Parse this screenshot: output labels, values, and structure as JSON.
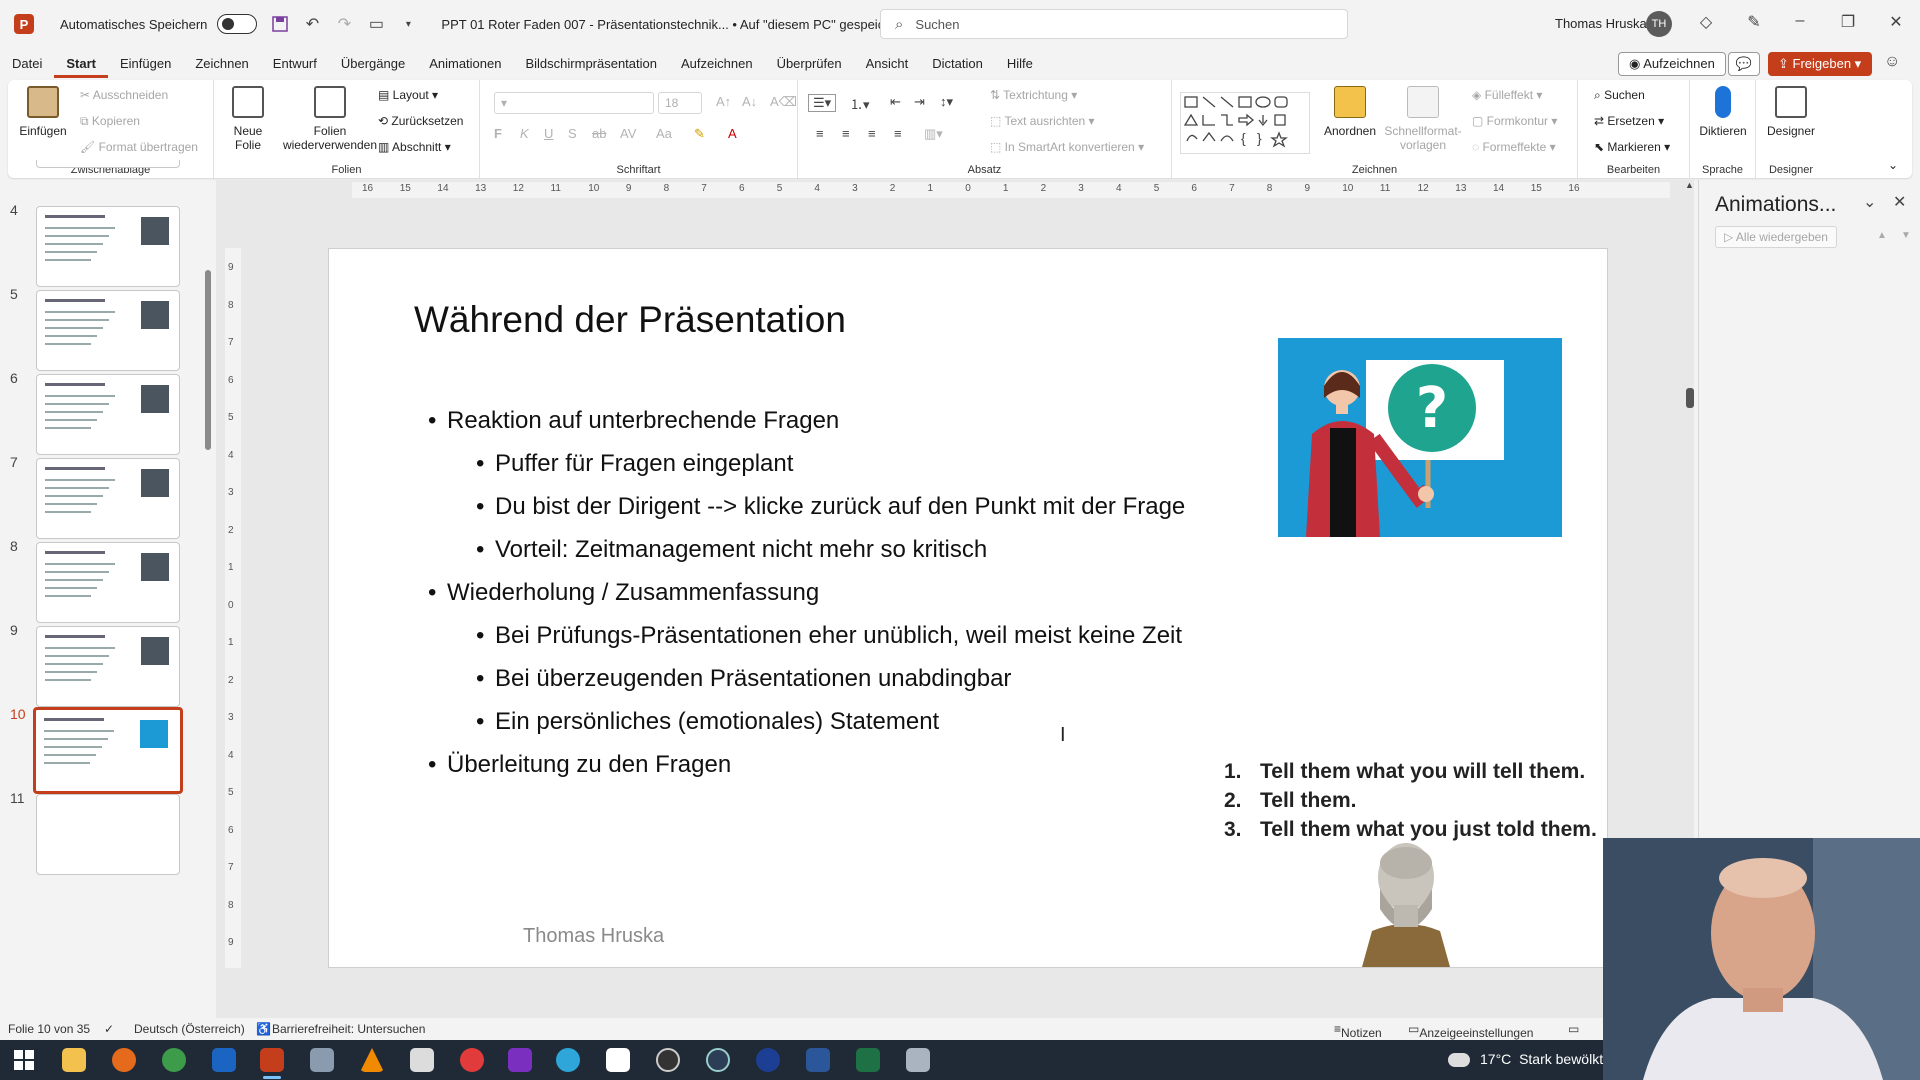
{
  "titlebar": {
    "autosave_label": "Automatisches Speichern",
    "doc_title": "PPT 01 Roter Faden 007 - Präsentationstechnik... • Auf \"diesem PC\" gespeichert",
    "search_placeholder": "Suchen",
    "user_name": "Thomas Hruska",
    "user_initials": "TH"
  },
  "menu": {
    "tabs": [
      "Datei",
      "Start",
      "Einfügen",
      "Zeichnen",
      "Entwurf",
      "Übergänge",
      "Animationen",
      "Bildschirmpräsentation",
      "Aufzeichnen",
      "Überprüfen",
      "Ansicht",
      "Dictation",
      "Hilfe"
    ],
    "active": "Start",
    "record_label": "Aufzeichnen",
    "share_label": "Freigeben"
  },
  "ribbon": {
    "clipboard": {
      "label": "Zwischenablage",
      "paste": "Einfügen",
      "cut": "Ausschneiden",
      "copy": "Kopieren",
      "format_painter": "Format übertragen"
    },
    "slides": {
      "label": "Folien",
      "new_slide": "Neue Folie",
      "reuse": "Folien wiederverwenden",
      "layout": "Layout",
      "reset": "Zurücksetzen",
      "section": "Abschnitt"
    },
    "font": {
      "label": "Schriftart",
      "size": "18"
    },
    "paragraph": {
      "label": "Absatz",
      "text_direction": "Textrichtung",
      "align_text": "Text ausrichten",
      "smartart": "In SmartArt konvertieren"
    },
    "drawing": {
      "label": "Zeichnen",
      "arrange": "Anordnen",
      "quick_styles": "Schnellformat-vorlagen",
      "fill": "Fülleffekt",
      "outline": "Formkontur",
      "effects": "Formeffekte"
    },
    "editing": {
      "label": "Bearbeiten",
      "find": "Suchen",
      "replace": "Ersetzen",
      "select": "Markieren"
    },
    "voice": {
      "label": "Sprache",
      "dictate": "Diktieren"
    },
    "designer": {
      "label": "Designer",
      "button": "Designer"
    }
  },
  "thumbnails": {
    "numbers": [
      "4",
      "5",
      "6",
      "7",
      "8",
      "9",
      "10",
      "11"
    ],
    "selected": "10"
  },
  "ruler": {
    "h_ticks": [
      "16",
      "15",
      "14",
      "13",
      "12",
      "11",
      "10",
      "9",
      "8",
      "7",
      "6",
      "5",
      "4",
      "3",
      "2",
      "1",
      "0",
      "1",
      "2",
      "3",
      "4",
      "5",
      "6",
      "7",
      "8",
      "9",
      "10",
      "11",
      "12",
      "13",
      "14",
      "15",
      "16"
    ],
    "v_ticks": [
      "9",
      "8",
      "7",
      "6",
      "5",
      "4",
      "3",
      "2",
      "1",
      "0",
      "1",
      "2",
      "3",
      "4",
      "5",
      "6",
      "7",
      "8",
      "9"
    ]
  },
  "slide": {
    "title": "Während der Präsentation",
    "bullets": [
      {
        "level": 1,
        "text": "Reaktion auf unterbrechende Fragen"
      },
      {
        "level": 2,
        "text": "Puffer für Fragen eingeplant"
      },
      {
        "level": 2,
        "text": "Du bist der Dirigent --> klicke zurück auf den Punkt mit der Frage"
      },
      {
        "level": 2,
        "text": "Vorteil: Zeitmanagement nicht mehr so kritisch"
      },
      {
        "level": 1,
        "text": "Wiederholung / Zusammenfassung"
      },
      {
        "level": 2,
        "text": "Bei Prüfungs-Präsentationen eher unüblich, weil meist keine Zeit"
      },
      {
        "level": 2,
        "text": "Bei überzeugenden Präsentationen unabdingbar"
      },
      {
        "level": 2,
        "text": "Ein persönliches (emotionales) Statement"
      },
      {
        "level": 1,
        "text": "Überleitung zu den Fragen"
      }
    ],
    "image_symbol": "?",
    "numbered": [
      {
        "n": "1.",
        "text": "Tell them what you will tell them."
      },
      {
        "n": "2.",
        "text": "Tell them."
      },
      {
        "n": "3.",
        "text": "Tell them what you just told them."
      }
    ],
    "footer": "Thomas Hruska"
  },
  "animpane": {
    "title": "Animations...",
    "play_all": "Alle wiedergeben"
  },
  "statusbar": {
    "slide_info": "Folie 10 von 35",
    "language": "Deutsch (Österreich)",
    "accessibility": "Barrierefreiheit: Untersuchen",
    "notes": "Notizen",
    "display_settings": "Anzeigeeinstellungen"
  },
  "taskbar": {
    "temperature": "17°C",
    "weather": "Stark bewölkt"
  },
  "colors": {
    "accent": "#c43e1c",
    "slide_image_bg": "#1b9ad6",
    "question_circle": "#1fa58f"
  }
}
